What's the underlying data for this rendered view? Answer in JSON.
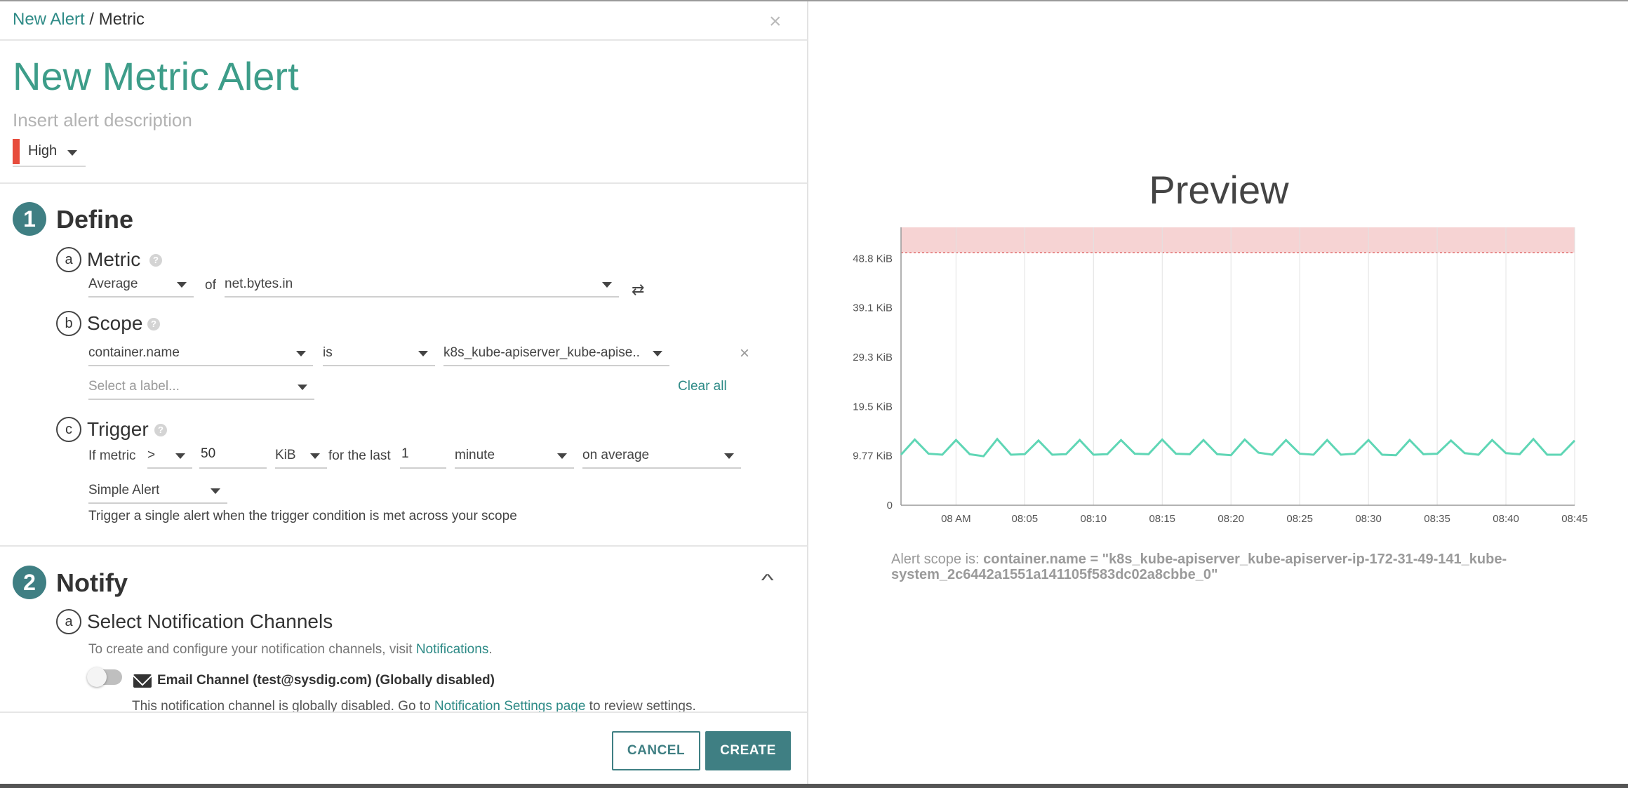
{
  "breadcrumb": {
    "parent": "New Alert",
    "separator": " / ",
    "current": "Metric"
  },
  "close_icon": "×",
  "title": "New Metric Alert",
  "description_placeholder": "Insert alert description",
  "severity": {
    "label": "High",
    "color": "#e74c3c"
  },
  "define": {
    "number": "1",
    "title": "Define",
    "metric": {
      "letter": "a",
      "title": "Metric",
      "aggregation": "Average",
      "of_label": "of",
      "metric_name": "net.bytes.in",
      "swap_icon": "⇄"
    },
    "scope": {
      "letter": "b",
      "title": "Scope",
      "label": "container.name",
      "operator": "is",
      "value": "k8s_kube-apiserver_kube-apise...",
      "remove_icon": "×",
      "label_placeholder": "Select a label...",
      "clear_all": "Clear all"
    },
    "trigger": {
      "letter": "c",
      "title": "Trigger",
      "if_metric": "If metric",
      "comparator": ">",
      "threshold": "50",
      "unit": "KiB",
      "for_the_last": "for the last",
      "duration": "1",
      "duration_unit": "minute",
      "aggregation": "on average",
      "alert_type": "Simple Alert",
      "help_text": "Trigger a single alert when the trigger condition is met across your scope"
    }
  },
  "notify": {
    "number": "2",
    "title": "Notify",
    "collapse_icon": "^",
    "channels": {
      "letter": "a",
      "title": "Select Notification Channels",
      "intro_prefix": "To create and configure your notification channels, visit ",
      "intro_link": "Notifications",
      "intro_suffix": ".",
      "email_channel": "Email Channel (test@sysdig.com) (Globally disabled)",
      "email_enabled": false,
      "disabled_prefix": "This notification channel is globally disabled. Go to ",
      "disabled_link": "Notification Settings page",
      "disabled_suffix": " to review settings."
    }
  },
  "footer": {
    "cancel": "CANCEL",
    "create": "CREATE"
  },
  "preview": {
    "title": "Preview",
    "scope_prefix": "Alert scope is: ",
    "scope_value": "container.name = \"k8s_kube-apiserver_kube-apiserver-ip-172-31-49-141_kube-system_2c6442a1551a141105f583dc02a8cbbe_0\""
  },
  "chart_data": {
    "type": "line",
    "y_ticks": [
      "0",
      "9.77 KiB",
      "19.5 KiB",
      "29.3 KiB",
      "39.1 KiB",
      "48.8 KiB"
    ],
    "y_tick_values": [
      0,
      9.77,
      19.5,
      29.3,
      39.1,
      48.8
    ],
    "ylim": [
      0,
      55
    ],
    "threshold": 50,
    "x_ticks": [
      "08 AM",
      "08:05",
      "08:10",
      "08:15",
      "08:20",
      "08:25",
      "08:30",
      "08:35",
      "08:40",
      "08:45"
    ],
    "xlim": [
      "07:56",
      "08:45"
    ],
    "series": [
      {
        "color": "#5fd6b5",
        "x": [
          "07:56",
          "07:57",
          "07:58",
          "07:59",
          "08:00",
          "08:01",
          "08:02",
          "08:03",
          "08:04",
          "08:05",
          "08:06",
          "08:07",
          "08:08",
          "08:09",
          "08:10",
          "08:11",
          "08:12",
          "08:13",
          "08:14",
          "08:15",
          "08:16",
          "08:17",
          "08:18",
          "08:19",
          "08:20",
          "08:21",
          "08:22",
          "08:23",
          "08:24",
          "08:25",
          "08:26",
          "08:27",
          "08:28",
          "08:29",
          "08:30",
          "08:31",
          "08:32",
          "08:33",
          "08:34",
          "08:35",
          "08:36",
          "08:37",
          "08:38",
          "08:39",
          "08:40",
          "08:41",
          "08:42",
          "08:43",
          "08:44",
          "08:45"
        ],
        "values": [
          10.0,
          13.0,
          10.2,
          10.0,
          12.9,
          10.1,
          9.7,
          13.1,
          10.0,
          10.1,
          12.8,
          10.0,
          10.1,
          12.9,
          10.0,
          10.1,
          12.9,
          10.2,
          10.1,
          13.0,
          10.2,
          10.1,
          12.9,
          10.1,
          9.9,
          13.0,
          10.4,
          10.0,
          12.9,
          10.2,
          10.0,
          12.9,
          10.0,
          10.2,
          12.9,
          10.0,
          9.9,
          12.9,
          10.1,
          10.2,
          12.8,
          10.3,
          10.0,
          12.9,
          10.3,
          10.1,
          13.1,
          10.0,
          10.0,
          12.8
        ]
      }
    ]
  }
}
